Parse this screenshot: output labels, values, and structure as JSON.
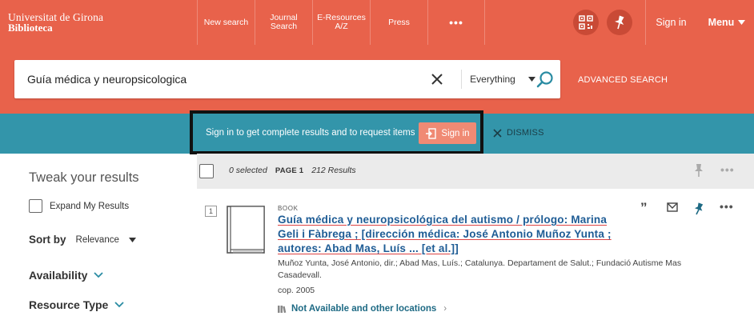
{
  "logo": {
    "line1": "Universitat de Girona",
    "line2": "Biblioteca"
  },
  "nav": {
    "new_search": "New search",
    "journal_search": "Journal Search",
    "eresources": "E-Resources A/Z",
    "press": "Press",
    "more": "•••",
    "sign_in": "Sign in",
    "menu": "Menu"
  },
  "search": {
    "query": "Guía médica y neuropsicologica",
    "scope": "Everything",
    "advanced": "ADVANCED SEARCH"
  },
  "banner": {
    "message": "Sign in to get complete results and to request items",
    "sign_in": "Sign in",
    "dismiss": "DISMISS"
  },
  "facets": {
    "title": "Tweak your results",
    "expand": "Expand My Results",
    "sort_label": "Sort by",
    "sort_value": "Relevance",
    "availability": "Availability",
    "resource_type": "Resource Type"
  },
  "results_header": {
    "selected": "0 selected",
    "page": "PAGE 1",
    "count": "212 Results"
  },
  "result": {
    "number": "1",
    "type": "BOOK",
    "title": "Guía médica y neuropsicológica del autismo / prólogo: Marina Geli i Fàbrega ; [dirección médica: José Antonio Muñoz Yunta ; autores: Abad Mas, Luís ... [et al.]]",
    "authors": "Muñoz Yunta, José Antonio, dir.; Abad Mas, Luís.; Catalunya. Departament de Salut.; Fundació Autisme Mas Casadevall.",
    "date": "cop. 2005",
    "availability": "Not Available and other locations"
  },
  "colors": {
    "brand": "#e8624b",
    "banner": "#3395aa",
    "link": "#1e5c95",
    "signin_button": "#f08a74"
  },
  "icons": [
    "qr-code-icon",
    "pin-icon",
    "chevron-down-icon",
    "clear-icon",
    "search-icon",
    "login-icon",
    "close-icon",
    "book-icon",
    "quote-icon",
    "email-icon",
    "more-icon",
    "library-icon"
  ]
}
